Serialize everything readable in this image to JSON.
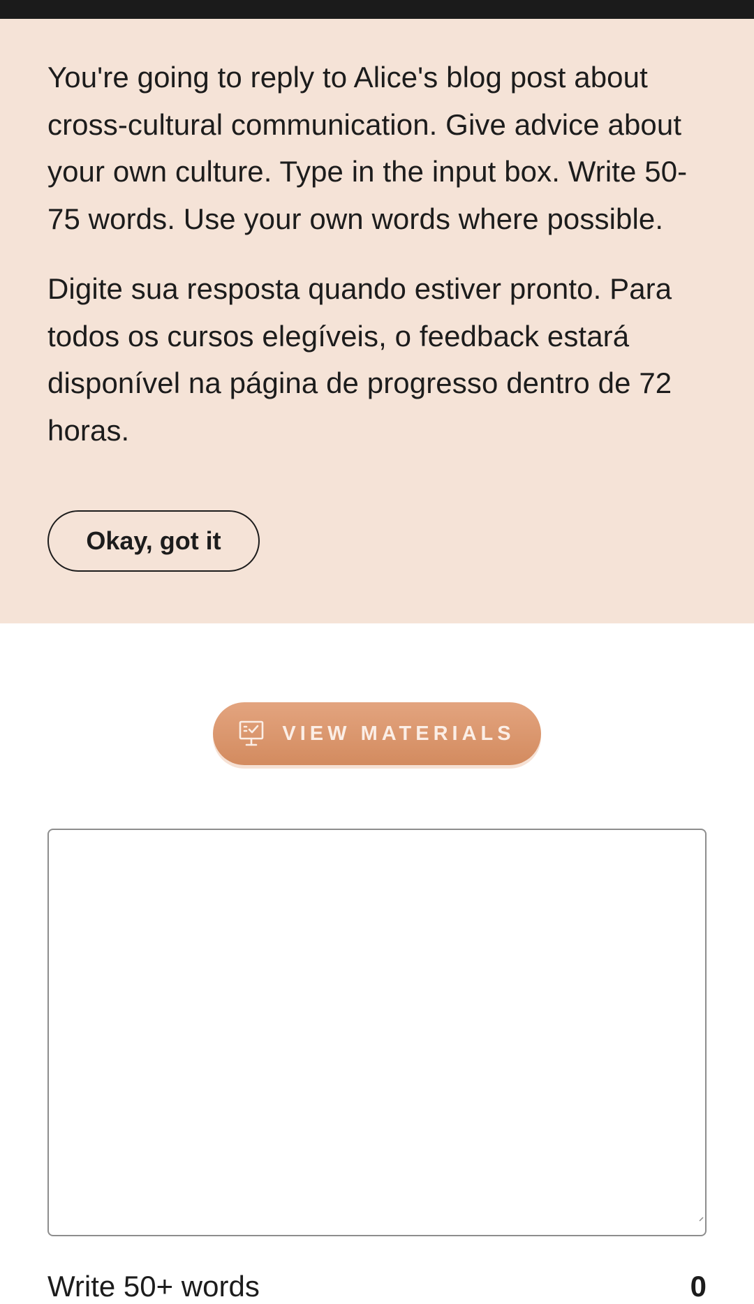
{
  "instructions": {
    "paragraph_en": "You're going to reply to Alice's blog post about cross-cultural communication. Give advice about your own culture. Type in the input box. Write 50-75 words. Use your own words where possible.",
    "paragraph_pt": "Digite sua resposta quando estiver pronto. Para todos os cursos elegíveis, o feedback estará disponível na página de progresso dentro de 72 horas.",
    "dismiss_label": "Okay, got it"
  },
  "materials": {
    "button_label": "VIEW MATERIALS",
    "icon": "presentation-board-icon"
  },
  "response": {
    "value": "",
    "placeholder": ""
  },
  "footer": {
    "hint": "Write 50+ words",
    "word_count": "0"
  },
  "colors": {
    "panel_background": "#f5e3d7",
    "accent": "#d9956b",
    "top_bar": "#1b1b1b",
    "text": "#1c1c1c"
  }
}
